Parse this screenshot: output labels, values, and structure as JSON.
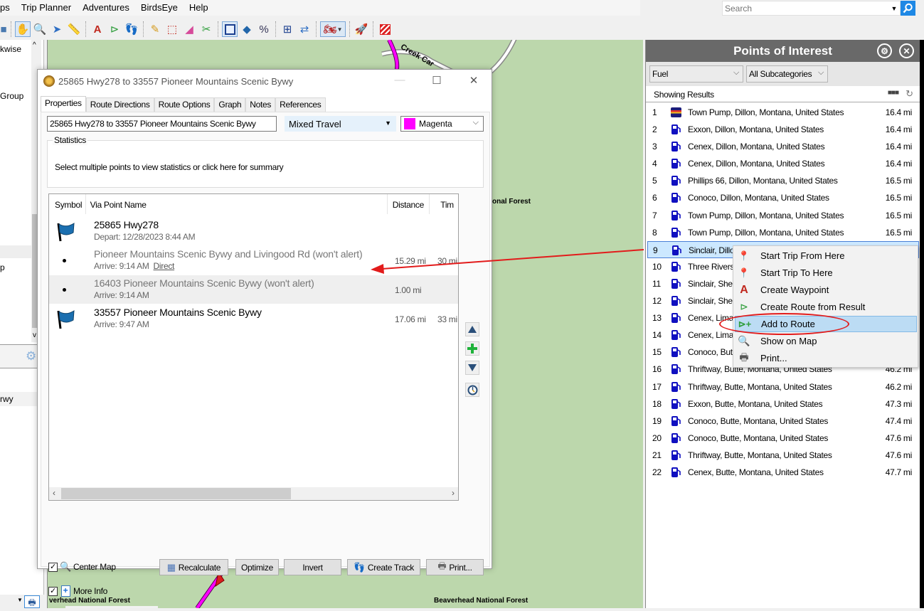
{
  "menubar": {
    "items": [
      "ps",
      "Trip Planner",
      "Adventures",
      "BirdsEye",
      "Help"
    ]
  },
  "search": {
    "placeholder": "Search"
  },
  "toolbar": {
    "icons": [
      "map-view-icon",
      "hand-pan-icon",
      "zoom-magnifier-icon",
      "select-arrow-icon",
      "measure-ruler-icon",
      "waypoint-flag-icon",
      "route-icon",
      "track-footprint-icon",
      "draw-pencil-icon",
      "selection-icon",
      "eraser-icon",
      "scissors-icon",
      "map-frame-icon",
      "3d-view-icon",
      "percent-icon",
      "fit-icon",
      "swap-icon",
      "motorcycle-profile-icon",
      "launch-rocket-icon",
      "no-entry-icon"
    ]
  },
  "left_panel": {
    "texts": [
      "kwise",
      "Group",
      "p",
      "rwy"
    ]
  },
  "map": {
    "labels": [
      "Creek Car",
      "onal Forest",
      "verhead National Forest",
      "Beaverhead National Forest"
    ],
    "route_color": "#ff00ff"
  },
  "route_dialog": {
    "title": "25865 Hwy278 to 33557 Pioneer Mountains Scenic Bywy",
    "tabs": [
      "Properties",
      "Route Directions",
      "Route Options",
      "Graph",
      "Notes",
      "References"
    ],
    "active_tab": "Properties",
    "route_name": "25865 Hwy278 to 33557 Pioneer Mountains Scenic Bywy",
    "travel_mode": "Mixed Travel",
    "color": {
      "label": "Magenta",
      "hex": "#ff00ff"
    },
    "statistics_label": "Statistics",
    "statistics_message": "Select multiple points to view statistics or click here for summary",
    "columns": [
      "Symbol",
      "Via Point Name",
      "Distance",
      "Tim"
    ],
    "via_points": [
      {
        "symbol": "flag",
        "name": "25865 Hwy278",
        "sub": "Depart: 12/28/2023 8:44 AM",
        "link": "",
        "distance": "",
        "time": "",
        "dim": false,
        "highlight": false
      },
      {
        "symbol": "dot",
        "name": "Pioneer Mountains Scenic Bywy and Livingood Rd (won't alert)",
        "sub": "Arrive: 9:14 AM",
        "link": "Direct",
        "distance": "15.29 mi",
        "time": "30 mi",
        "dim": true,
        "highlight": false
      },
      {
        "symbol": "dot",
        "name": "16403 Pioneer Mountains Scenic Bywy (won't alert)",
        "sub": "Arrive: 9:14 AM",
        "link": "",
        "distance": "1.00 mi",
        "time": "",
        "dim": true,
        "highlight": true
      },
      {
        "symbol": "flag",
        "name": "33557 Pioneer Mountains Scenic Bywy",
        "sub": "Arrive: 9:47 AM",
        "link": "",
        "distance": "17.06 mi",
        "time": "33 mi",
        "dim": false,
        "highlight": false
      }
    ],
    "center_map_label": "Center Map",
    "more_info_label": "More Info",
    "center_map_checked": true,
    "more_info_checked": true,
    "buttons": {
      "recalculate": "Recalculate",
      "optimize": "Optimize",
      "invert": "Invert",
      "create_track": "Create Track",
      "print": "Print..."
    }
  },
  "poi_panel": {
    "title": "Points of Interest",
    "category": "Fuel",
    "subcategory": "All Subcategories",
    "showing": "Showing Results",
    "selected_index": 9,
    "results": [
      {
        "n": "1",
        "name": "Town Pump, Dillon, Montana, United States",
        "dist": "16.4 mi",
        "icon": "truck-stop"
      },
      {
        "n": "2",
        "name": "Exxon, Dillon, Montana, United States",
        "dist": "16.4 mi",
        "icon": "fuel"
      },
      {
        "n": "3",
        "name": "Cenex, Dillon, Montana, United States",
        "dist": "16.4 mi",
        "icon": "fuel"
      },
      {
        "n": "4",
        "name": "Cenex, Dillon, Montana, United States",
        "dist": "16.4 mi",
        "icon": "fuel"
      },
      {
        "n": "5",
        "name": "Phillips 66, Dillon, Montana, United States",
        "dist": "16.5 mi",
        "icon": "fuel"
      },
      {
        "n": "6",
        "name": "Conoco, Dillon, Montana, United States",
        "dist": "16.5 mi",
        "icon": "fuel"
      },
      {
        "n": "7",
        "name": "Town Pump, Dillon, Montana, United States",
        "dist": "16.5 mi",
        "icon": "fuel"
      },
      {
        "n": "8",
        "name": "Town Pump, Dillon, Montana, United States",
        "dist": "16.5 mi",
        "icon": "fuel"
      },
      {
        "n": "9",
        "name": "Sinclair, Dillo",
        "dist": "",
        "icon": "fuel"
      },
      {
        "n": "10",
        "name": "Three Rivers",
        "dist": "",
        "icon": "fuel"
      },
      {
        "n": "11",
        "name": "Sinclair, She",
        "dist": "",
        "icon": "fuel"
      },
      {
        "n": "12",
        "name": "Sinclair, She",
        "dist": "",
        "icon": "fuel"
      },
      {
        "n": "13",
        "name": "Cenex, Lima",
        "dist": "",
        "icon": "fuel"
      },
      {
        "n": "14",
        "name": "Cenex, Lima",
        "dist": "",
        "icon": "fuel"
      },
      {
        "n": "15",
        "name": "Conoco, But",
        "dist": "",
        "icon": "fuel"
      },
      {
        "n": "16",
        "name": "Thriftway, Butte, Montana, United States",
        "dist": "46.2 mi",
        "icon": "fuel"
      },
      {
        "n": "17",
        "name": "Thriftway, Butte, Montana, United States",
        "dist": "46.2 mi",
        "icon": "fuel"
      },
      {
        "n": "18",
        "name": "Exxon, Butte, Montana, United States",
        "dist": "47.3 mi",
        "icon": "fuel"
      },
      {
        "n": "19",
        "name": "Conoco, Butte, Montana, United States",
        "dist": "47.4 mi",
        "icon": "fuel"
      },
      {
        "n": "20",
        "name": "Conoco, Butte, Montana, United States",
        "dist": "47.6 mi",
        "icon": "fuel"
      },
      {
        "n": "21",
        "name": "Thriftway, Butte, Montana, United States",
        "dist": "47.6 mi",
        "icon": "fuel"
      },
      {
        "n": "22",
        "name": "Cenex, Butte, Montana, United States",
        "dist": "47.7 mi",
        "icon": "fuel"
      }
    ]
  },
  "context_menu": {
    "items": [
      {
        "label": "Start Trip From Here",
        "icon": "pushpins-icon"
      },
      {
        "label": "Start Trip To Here",
        "icon": "pushpins-icon"
      },
      {
        "label": "Create Waypoint",
        "icon": "waypoint-flag-icon"
      },
      {
        "label": "Create Route from Result",
        "icon": "route-icon"
      },
      {
        "label": "Add to Route",
        "icon": "add-route-icon",
        "highlight": true
      },
      {
        "label": "Show on Map",
        "icon": "map-magnifier-icon"
      },
      {
        "label": "Print...",
        "icon": "printer-icon"
      }
    ]
  },
  "annotation": {
    "color": "#e21b1b"
  }
}
